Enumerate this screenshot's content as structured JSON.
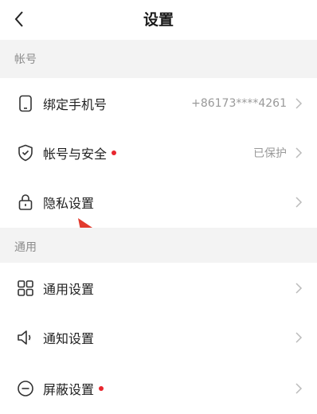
{
  "header": {
    "title": "设置"
  },
  "sections": [
    {
      "label": "帐号",
      "items": [
        {
          "label": "绑定手机号",
          "value": "+86173****4261",
          "dot": false,
          "icon": "phone-icon"
        },
        {
          "label": "帐号与安全",
          "value": "已保护",
          "dot": true,
          "icon": "shield-check-icon"
        },
        {
          "label": "隐私设置",
          "value": "",
          "dot": false,
          "icon": "lock-icon"
        }
      ]
    },
    {
      "label": "通用",
      "items": [
        {
          "label": "通用设置",
          "value": "",
          "dot": false,
          "icon": "grid-icon"
        },
        {
          "label": "通知设置",
          "value": "",
          "dot": false,
          "icon": "speaker-icon"
        },
        {
          "label": "屏蔽设置",
          "value": "",
          "dot": true,
          "icon": "block-icon"
        }
      ]
    }
  ],
  "colors": {
    "accent_dot": "#e8262e",
    "annotation_arrow": "#e23b2e",
    "section_bg": "#f3f3f3"
  }
}
